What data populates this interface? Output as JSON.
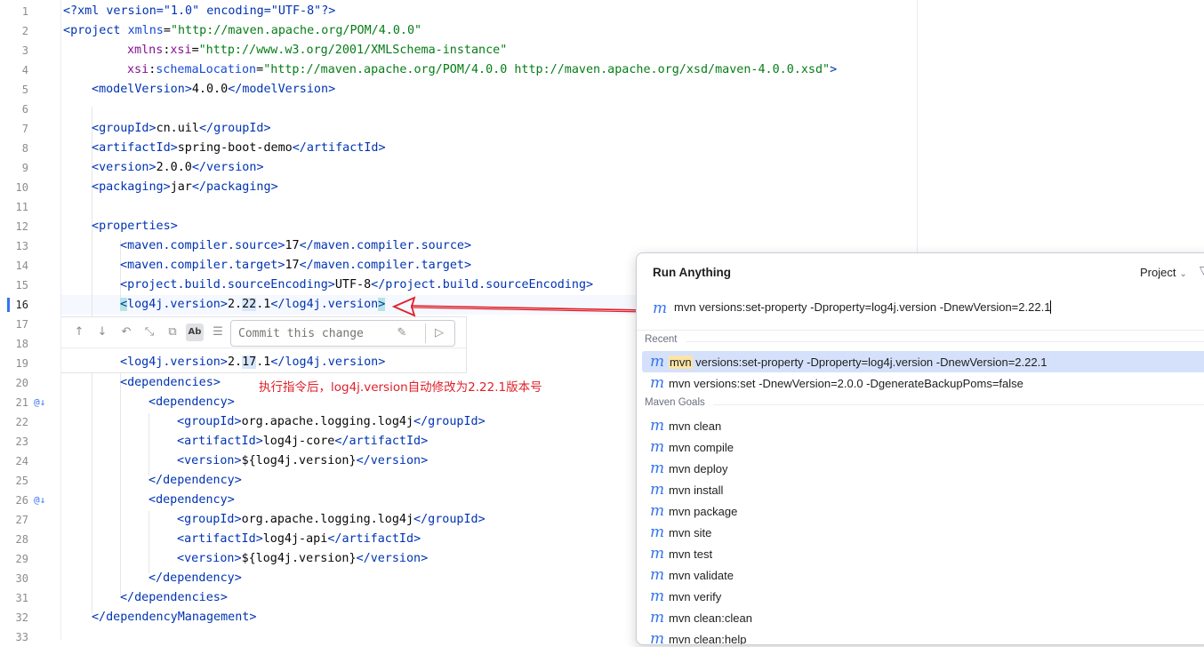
{
  "editor": {
    "line_numbers": [
      "1",
      "2",
      "3",
      "4",
      "5",
      "6",
      "7",
      "8",
      "9",
      "10",
      "11",
      "12",
      "13",
      "14",
      "15",
      "16",
      "17",
      "18",
      "19",
      "20",
      "21",
      "22",
      "23",
      "24",
      "25",
      "26",
      "27",
      "28",
      "29",
      "30",
      "31",
      "32",
      "33"
    ],
    "current_line": "16",
    "gutter_icon_lines": [
      "21",
      "26"
    ],
    "code": {
      "l1_text": "<?xml version=\"1.0\" encoding=\"UTF-8\"?>",
      "l2_tag": "project",
      "l2_attr": "xmlns",
      "l2_val": "\"http://maven.apache.org/POM/4.0.0\"",
      "l3_ns": "xmlns",
      "l3_attr": "xsi",
      "l3_val": "\"http://www.w3.org/2001/XMLSchema-instance\"",
      "l4_ns": "xsi",
      "l4_attr": "schemaLocation",
      "l4_val": "\"http://maven.apache.org/POM/4.0.0 http://maven.apache.org/xsd/maven-4.0.0.xsd\"",
      "model_tag": "modelVersion",
      "model_val": "4.0.0",
      "group_tag": "groupId",
      "group_val": "cn.uil",
      "artifact_tag": "artifactId",
      "artifact_val": "spring-boot-demo",
      "version_tag": "version",
      "version_val": "2.0.0",
      "packaging_tag": "packaging",
      "packaging_val": "jar",
      "properties_tag": "properties",
      "mcs_tag": "maven.compiler.source",
      "mcs_val": "17",
      "mct_tag": "maven.compiler.target",
      "mct_val": "17",
      "pbse_tag": "project.build.sourceEncoding",
      "pbse_val": "UTF-8",
      "log4j_tag": "log4j.version",
      "l16_val_a": "2.",
      "l16_val_b": "22",
      "l16_val_c": ".1",
      "l19_val_a": "2.",
      "l19_val_b": "17",
      "l19_val_c": ".1",
      "dependencies_tag": "dependencies",
      "dependency_tag": "dependency",
      "dep_group_val": "org.apache.logging.log4j",
      "dep1_artifact_val": "log4j-core",
      "dep2_artifact_val": "log4j-api",
      "dep_version_val": "${log4j.version}",
      "dep_mgmt_tag": "dependencyManagement"
    }
  },
  "diff_toolbar": {
    "commit_placeholder": "Commit this change",
    "word_toggle": "Ab"
  },
  "annotation": "执行指令后，log4j.version自动修改为2.22.1版本号",
  "run_anything": {
    "title": "Run Anything",
    "scope": "Project",
    "query": "mvn versions:set-property -Dproperty=log4j.version -DnewVersion=2.22.1",
    "recent_label": "Recent",
    "recent": [
      {
        "prefix": "mvn",
        "rest": " versions:set-property -Dproperty=log4j.version -DnewVersion=2.22.1"
      },
      {
        "prefix": "",
        "rest": "mvn versions:set -DnewVersion=2.0.0 -DgenerateBackupPoms=false"
      }
    ],
    "goals_label": "Maven Goals",
    "goals": [
      "mvn clean",
      "mvn compile",
      "mvn deploy",
      "mvn install",
      "mvn package",
      "mvn site",
      "mvn test",
      "mvn validate",
      "mvn verify",
      "mvn clean:clean",
      "mvn clean:help"
    ]
  },
  "colors": {
    "tag": "#0033b3",
    "attr": "#174ad4",
    "namespace": "#871094",
    "string": "#067d17",
    "annotation": "#e0202a",
    "maven_icon": "#3574f0",
    "selection": "#d5e1fb"
  },
  "icons": [
    "maven-icon",
    "arrow-up-icon",
    "arrow-down-icon",
    "revert-icon",
    "collapse-icon",
    "copy-icon",
    "word-diff-icon",
    "comment-icon",
    "eraser-icon",
    "send-icon",
    "override-gutter-icon",
    "chevron-down-icon",
    "filter-icon"
  ]
}
